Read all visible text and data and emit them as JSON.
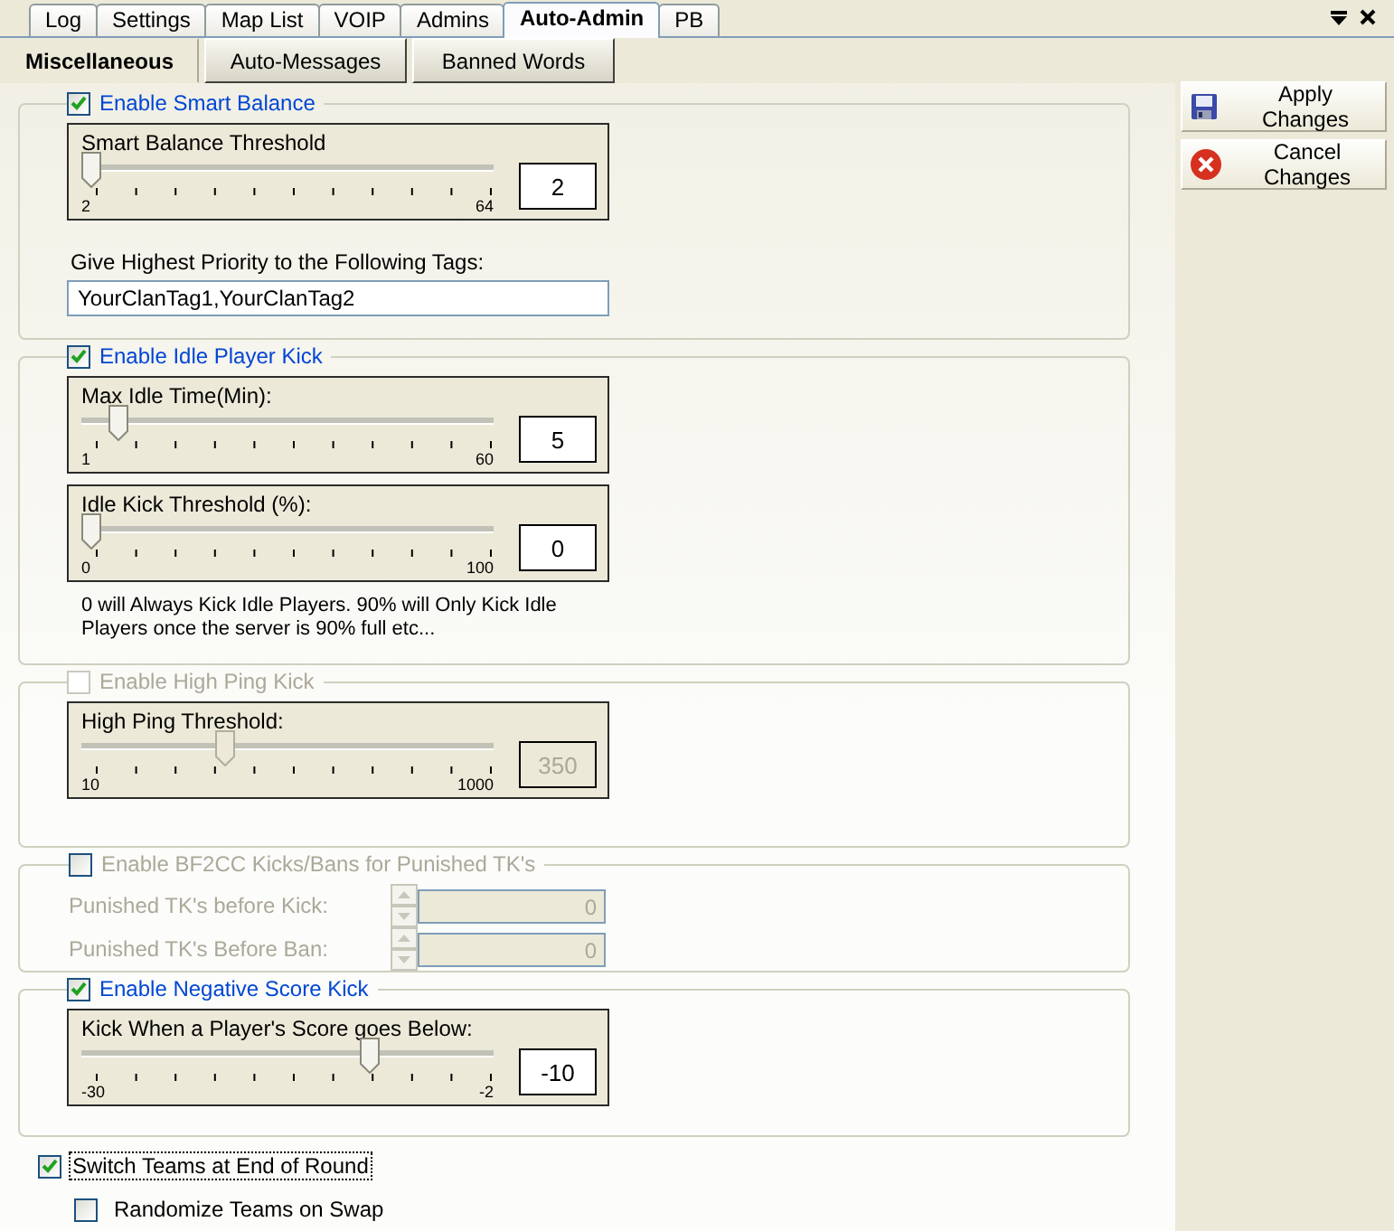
{
  "tabs": [
    {
      "label": "Log",
      "selected": false
    },
    {
      "label": "Settings",
      "selected": false
    },
    {
      "label": "Map List",
      "selected": false
    },
    {
      "label": "VOIP",
      "selected": false
    },
    {
      "label": "Admins",
      "selected": false
    },
    {
      "label": "Auto-Admin",
      "selected": true
    },
    {
      "label": "PB",
      "selected": false
    }
  ],
  "subtabs": [
    {
      "label": "Miscellaneous",
      "selected": true
    },
    {
      "label": "Auto-Messages",
      "selected": false
    },
    {
      "label": "Banned Words",
      "selected": false
    }
  ],
  "groups": [
    {
      "title": "Enable Smart Balance",
      "checked": true,
      "disabled": false,
      "items": [
        {
          "kind": "slider",
          "label": "Smart Balance Threshold",
          "level": 0,
          "min_label": "2",
          "max_label": "64",
          "value": "2",
          "disabled": false
        },
        {
          "kind": "text",
          "label": "Give Highest Priority to the Following Tags:"
        },
        {
          "kind": "field",
          "value": "YourClanTag1,YourClanTag2"
        }
      ]
    },
    {
      "title": "Enable Idle Player Kick",
      "checked": true,
      "disabled": false,
      "items": [
        {
          "kind": "slider",
          "label": "Max Idle Time(Min):",
          "level": 0.07,
          "min_label": "1",
          "max_label": "60",
          "value": "5",
          "disabled": false
        },
        {
          "kind": "slider",
          "label": "Idle Kick Threshold (%):",
          "level": 0,
          "min_label": "0",
          "max_label": "100",
          "value": "0",
          "disabled": false
        },
        {
          "kind": "note",
          "label": "0 will Always Kick Idle Players. 90% will Only Kick Idle Players once the server is 90% full etc..."
        }
      ]
    },
    {
      "title": "Enable High Ping Kick",
      "checked": false,
      "disabled": true,
      "items": [
        {
          "kind": "slider",
          "label": "High Ping Threshold:",
          "level": 0.34,
          "min_label": "10",
          "max_label": "1000",
          "value": "350",
          "disabled": true
        }
      ]
    },
    {
      "title": "Enable BF2CC Kicks/Bans for Punished TK's",
      "checked": false,
      "disabled": false,
      "items": [
        {
          "kind": "spin",
          "label": "Punished TK's before Kick:",
          "value": "0",
          "disabled": true
        },
        {
          "kind": "spin",
          "label": "Punished TK's Before Ban:",
          "value": "0",
          "disabled": true
        }
      ]
    },
    {
      "title": "Enable Negative Score Kick",
      "checked": true,
      "disabled": false,
      "items": [
        {
          "kind": "slider",
          "label": "Kick When a Player's Score goes Below:",
          "level": 0.71,
          "min_label": "-30",
          "max_label": "-2",
          "value": "-10",
          "disabled": false
        }
      ]
    }
  ],
  "options": [
    {
      "label": "Switch Teams at End of Round",
      "checked": true,
      "focused": true,
      "children": [
        {
          "label": "Randomize Teams on Swap",
          "checked": false,
          "focused": false
        }
      ]
    }
  ],
  "actions": [
    {
      "kind": "save",
      "label": "Apply Changes"
    },
    {
      "kind": "cancel",
      "label": "Cancel Changes"
    }
  ]
}
